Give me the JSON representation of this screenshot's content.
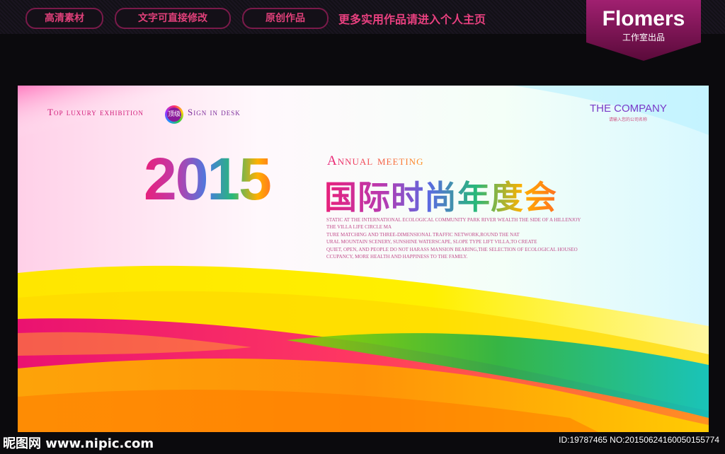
{
  "header": {
    "pills": [
      "高清素材",
      "文字可直接修改",
      "原创作品"
    ],
    "promo": "更多实用作品请进入个人主页",
    "brand_name": "Flomers",
    "brand_sub": "工作室出品"
  },
  "poster": {
    "top_left_1": "Top luxury exhibition",
    "badge": "顶级",
    "top_left_2": "Sign in desk",
    "company": "THE COMPANY",
    "company_sub": "请输入您的公司名称",
    "year": "2015",
    "annual": "Annual meeting",
    "cn_title": "国际时尚年度会",
    "body_lines": [
      "STATIC AT THE INTERNATIONAL ECOLOGICAL COMMUNITY PARK RIVER WEALTH THE SIDE OF A HILLENJOY",
      "THE VILLA LIFE CIRCLE MA",
      "TURE MATCHING AND THREE-DIMENSIONAL TRAFFIC NETWORK,ROUND THE NAT",
      "URAL MOUNTAIN SCENERY, SUNSHINE WATERSCAPE, SLOPE TYPE LIFT VILLA,TO CREATE",
      "QUIET, OPEN, AND PEOPLE DO NOT HARASS MANSION BEARING,THE SELECTION OF ECOLOGICAL HOUSEO",
      "CCUPANCY, MORE HEALTH AND HAPPINESS TO THE FAMILY."
    ]
  },
  "footer": {
    "left": "昵图网 www.nipic.com",
    "right": "ID:19787465 NO:20150624160050155774"
  }
}
